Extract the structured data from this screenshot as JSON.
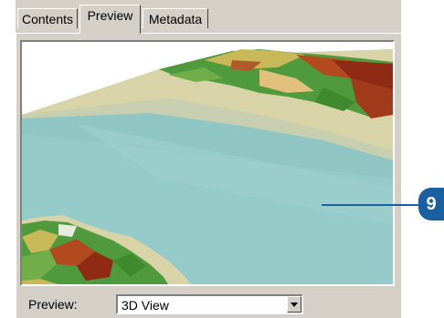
{
  "tabs": [
    {
      "label": "Contents",
      "active": false
    },
    {
      "label": "Preview",
      "active": true
    },
    {
      "label": "Metadata",
      "active": false
    }
  ],
  "preview": {
    "label": "Preview:",
    "selected_view": "3D View"
  },
  "callout": {
    "number": "9",
    "color": "#1a5fa0"
  },
  "icons": {
    "dropdown": "chevron-down-icon"
  },
  "colors": {
    "water": "#8fc8c6",
    "sand": "#d9d4a8",
    "panel": "#d4d0c8"
  }
}
